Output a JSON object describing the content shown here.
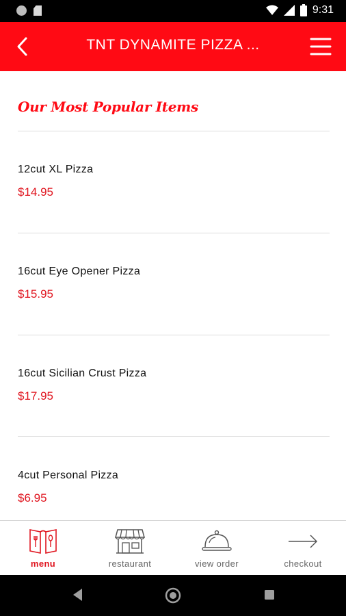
{
  "status_bar": {
    "time": "9:31"
  },
  "app_bar": {
    "title": "TNT DYNAMITE PIZZA ..."
  },
  "section": {
    "title": "Our Most Popular Items"
  },
  "items": [
    {
      "name": "12cut XL Pizza",
      "price": "$14.95"
    },
    {
      "name": "16cut Eye Opener Pizza",
      "price": "$15.95"
    },
    {
      "name": "16cut Sicilian Crust Pizza",
      "price": "$17.95"
    },
    {
      "name": "4cut Personal Pizza",
      "price": "$6.95"
    }
  ],
  "bottom_nav": [
    {
      "label": "menu",
      "icon": "menu-book-icon",
      "active": true
    },
    {
      "label": "restaurant",
      "icon": "storefront-icon",
      "active": false
    },
    {
      "label": "view order",
      "icon": "cloche-icon",
      "active": false
    },
    {
      "label": "checkout",
      "icon": "arrow-right-icon",
      "active": false
    }
  ],
  "colors": {
    "accent": "#ff0a14",
    "price": "#e0151f",
    "text": "#111111",
    "muted": "#666666"
  }
}
